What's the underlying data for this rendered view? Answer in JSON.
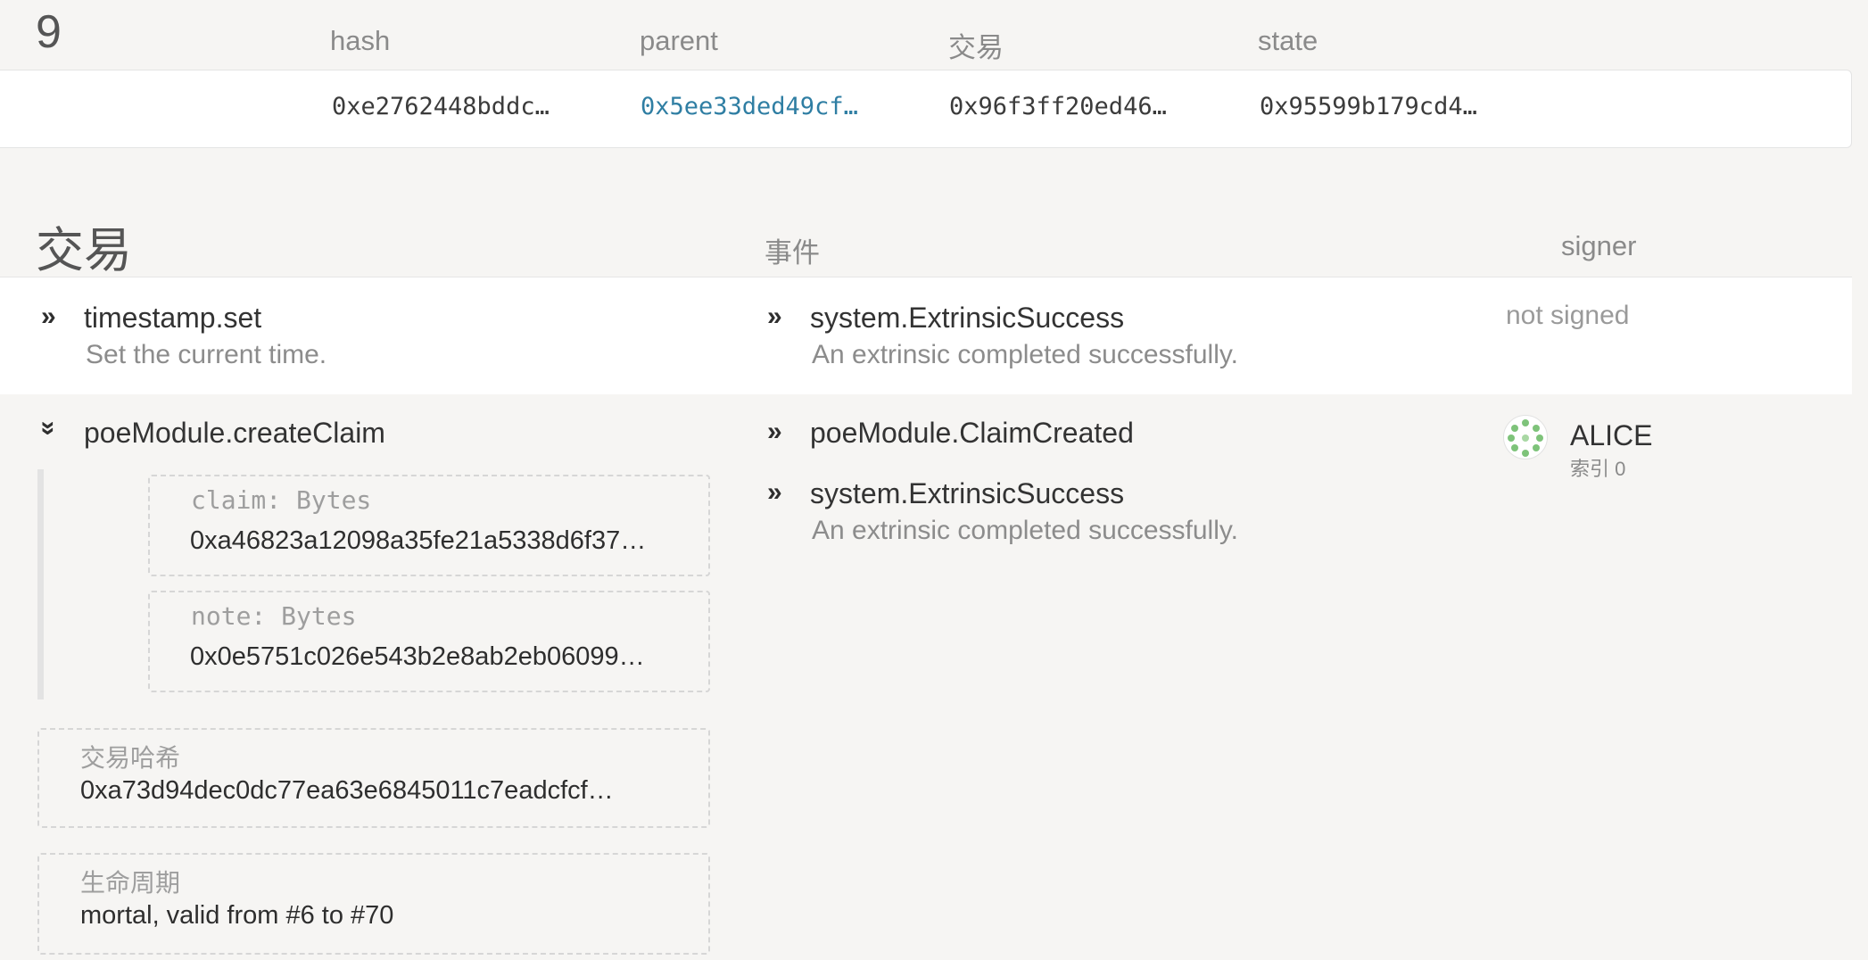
{
  "block": {
    "number": "9",
    "columns": {
      "hash": "hash",
      "parent": "parent",
      "extrinsics": "交易",
      "state": "state"
    },
    "hash": "0xe2762448bddc…",
    "parent": "0x5ee33ded49cf…",
    "extrinsics_root": "0x96f3ff20ed46…",
    "state_root": "0x95599b179cd4…"
  },
  "extrinsics_section": {
    "title": "交易",
    "events_header": "事件",
    "signer_header": "signer"
  },
  "extrinsics": [
    {
      "call": "timestamp.set",
      "description": "Set the current time.",
      "signer": "not signed",
      "events": [
        {
          "name": "system.ExtrinsicSuccess",
          "description": "An extrinsic completed successfully."
        }
      ]
    },
    {
      "call": "poeModule.createClaim",
      "params": [
        {
          "label": "claim: Bytes",
          "value": "0xa46823a12098a35fe21a5338d6f37…"
        },
        {
          "label": "note: Bytes",
          "value": "0x0e5751c026e543b2e8ab2eb06099…"
        }
      ],
      "hash_label": "交易哈希",
      "hash_value": "0xa73d94dec0dc77ea63e6845011c7eadcfcf…",
      "lifetime_label": "生命周期",
      "lifetime_value": "mortal, valid from #6 to #70",
      "signer_name": "ALICE",
      "signer_index": "索引 0",
      "events": [
        {
          "name": "poeModule.ClaimCreated"
        },
        {
          "name": "system.ExtrinsicSuccess",
          "description": "An extrinsic completed successfully."
        }
      ]
    }
  ],
  "icons": {
    "expand": "double-chevron-right-icon",
    "collapse": "double-chevron-down-icon",
    "identicon": "identicon-icon"
  },
  "colors": {
    "link": "#2f7ea3",
    "background": "#f6f5f3",
    "row": "#ffffff",
    "identicon": "#7ec37a"
  }
}
